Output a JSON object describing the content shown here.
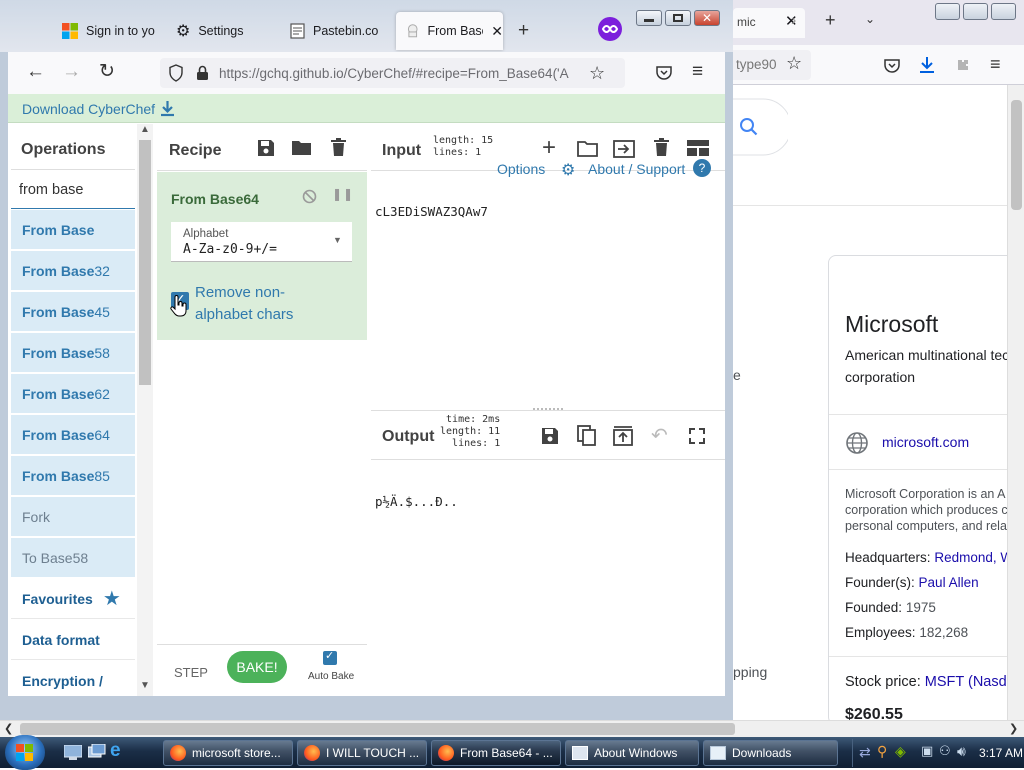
{
  "tabs": [
    {
      "label": "Sign in to yo"
    },
    {
      "label": "Settings"
    },
    {
      "label": "Pastebin.co"
    },
    {
      "label": "From Base"
    }
  ],
  "bg_tab_label": "mic",
  "url": "https://gchq.github.io/CyberChef/#recipe=From_Base64('A",
  "bg_url": "type90",
  "banner": {
    "label": "Download CyberChef"
  },
  "operations": {
    "title": "Operations",
    "search_value": "from base",
    "results": [
      {
        "bold": "From Base",
        "rest": ""
      },
      {
        "bold": "From Base",
        "rest": "32"
      },
      {
        "bold": "From Base",
        "rest": "45"
      },
      {
        "bold": "From Base",
        "rest": "58"
      },
      {
        "bold": "From Base",
        "rest": "62"
      },
      {
        "bold": "From Base",
        "rest": "64"
      },
      {
        "bold": "From Base",
        "rest": "85"
      },
      {
        "bold": "",
        "rest": "Fork"
      },
      {
        "bold": "",
        "rest": "To Base58"
      }
    ],
    "categories": [
      {
        "label": "Favourites"
      },
      {
        "label": "Data format"
      },
      {
        "label": "Encryption /"
      }
    ]
  },
  "recipe": {
    "title": "Recipe",
    "op_name": "From Base64",
    "alphabet_label": "Alphabet",
    "alphabet_value": "A-Za-z0-9+/=",
    "remove_label_line1": "Remove non-",
    "remove_label_line2": "alphabet chars",
    "step_label": "STEP",
    "bake_label": "BAKE!",
    "auto_bake_label": "Auto Bake"
  },
  "input": {
    "title": "Input",
    "length_text": "length: 15",
    "lines_text": "lines:  1",
    "value": "cL3EDiSWAZ3QAw7",
    "options_text": "Options",
    "about_text": "About / Support"
  },
  "output": {
    "title": "Output",
    "time_text": "time:  2ms",
    "length_text": "length:  11",
    "lines_text": "lines:   1",
    "value": "p½Ä.$...Ð.."
  },
  "knowledge_panel": {
    "title": "Microsoft",
    "subtitle_line1": "American multinational tec",
    "subtitle_line2": "corporation",
    "website": "microsoft.com",
    "desc_line1": "Microsoft Corporation is an A",
    "desc_line2": "corporation which produces c",
    "desc_line3": "personal computers, and rela",
    "facts": [
      {
        "label": "Headquarters:",
        "value": "Redmond, W",
        "link": true
      },
      {
        "label": "Founder(s):",
        "value": "Paul Allen",
        "link": true
      },
      {
        "label": "Founded:",
        "value": "1975",
        "link": false
      },
      {
        "label": "Employees:",
        "value": "182,268",
        "link": false
      }
    ],
    "stock_label": "Stock price:",
    "stock_value": "MSFT (Nasda",
    "stock_price": "$260.55"
  },
  "bg_fragments": {
    "e": "e",
    "pping": "pping"
  },
  "taskbar": {
    "items": [
      {
        "label": "microsoft store..."
      },
      {
        "label": "I WILL TOUCH ..."
      },
      {
        "label": "From Base64 - ..."
      },
      {
        "label": "About Windows"
      },
      {
        "label": "Downloads"
      }
    ],
    "clock": "3:17 AM"
  },
  "colors": {
    "accent_blue": "#3079ad",
    "bake_green": "#4cb25a",
    "banner_green": "#daefd8"
  }
}
